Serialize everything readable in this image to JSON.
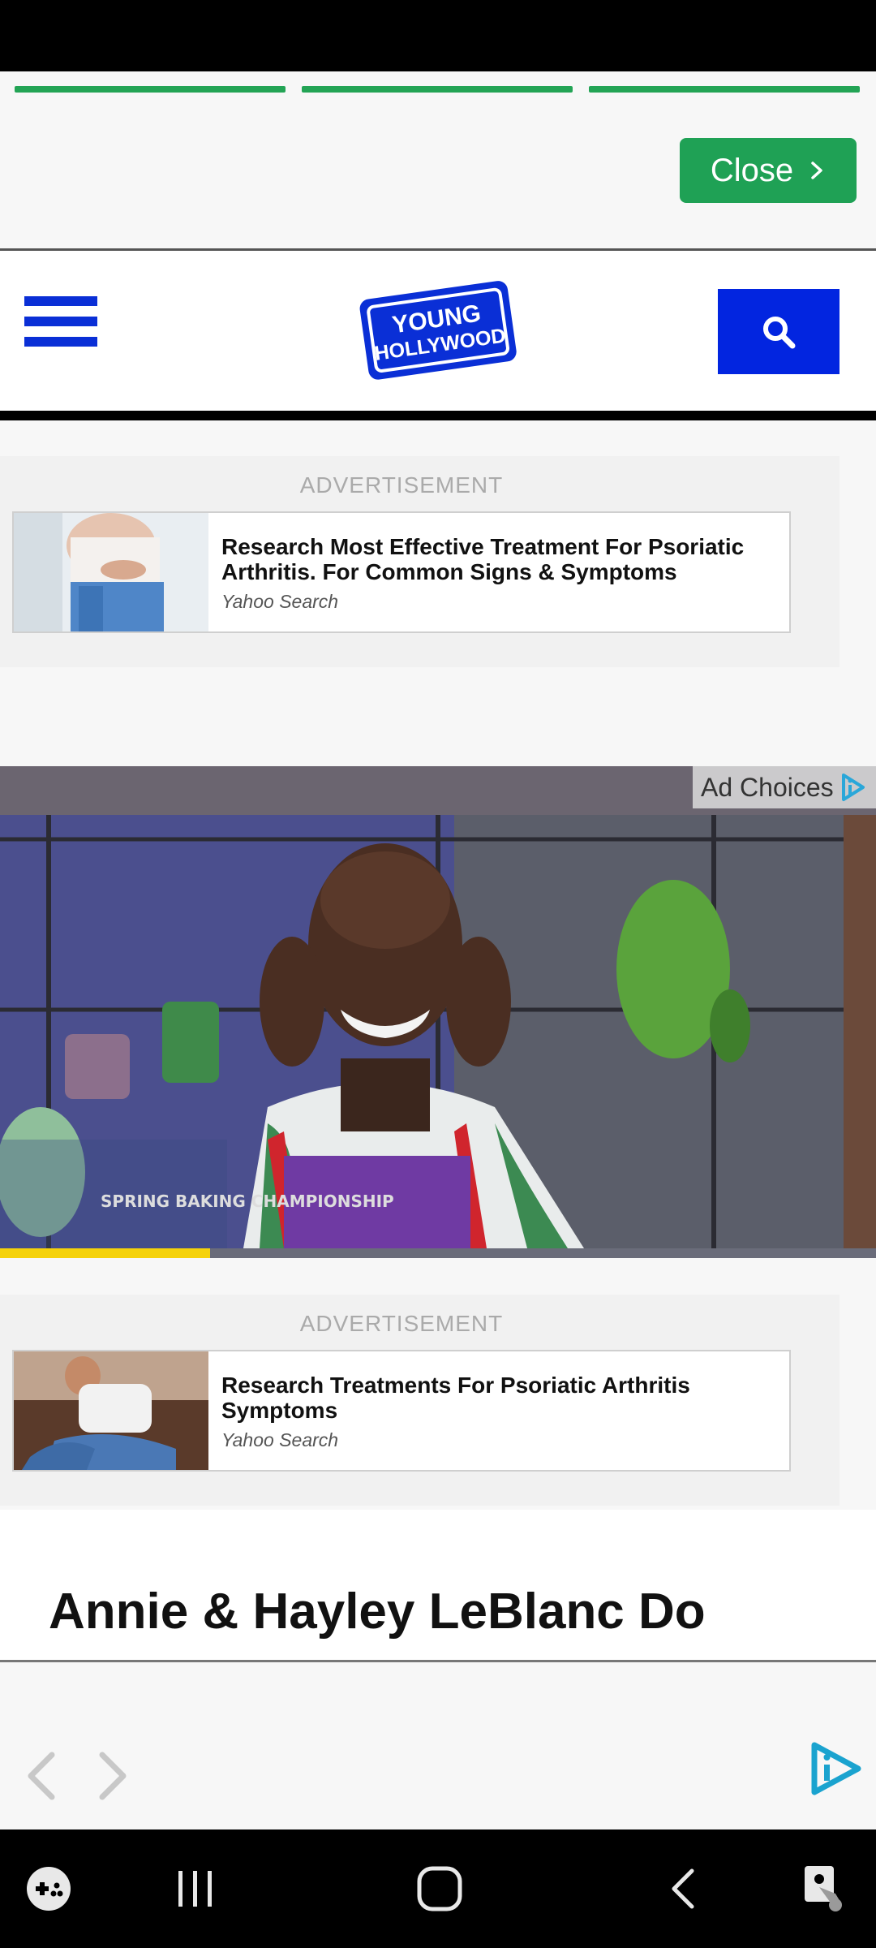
{
  "stories": {
    "progress_segments": [
      1,
      1,
      1
    ],
    "close_label": "Close"
  },
  "header": {
    "logo_line1": "YOUNG",
    "logo_line2": "HOLLYWOOD"
  },
  "ads": [
    {
      "label": "ADVERTISEMENT",
      "title": "Research Most Effective Treatment For Psoriatic Arthritis. For Common Signs & Symptoms",
      "source": "Yahoo Search"
    },
    {
      "label": "ADVERTISEMENT",
      "title": "Research Treatments For Psoriatic Arthritis Symptoms",
      "source": "Yahoo Search"
    }
  ],
  "video": {
    "ad_choices_label": "Ad Choices",
    "caption": "SPRING BAKING CHAMPIONSHIP",
    "progress_fraction": 0.24
  },
  "article": {
    "headline": "Annie & Hayley LeBlanc Do"
  },
  "colors": {
    "brand_blue": "#0225e0",
    "close_green": "#1fa155",
    "progress_yellow": "#f5d20b"
  },
  "icons": {
    "menu": "hamburger-icon",
    "search": "search-icon",
    "prev": "chevron-left-icon",
    "next": "chevron-right-icon",
    "brand": "play-info-icon"
  }
}
